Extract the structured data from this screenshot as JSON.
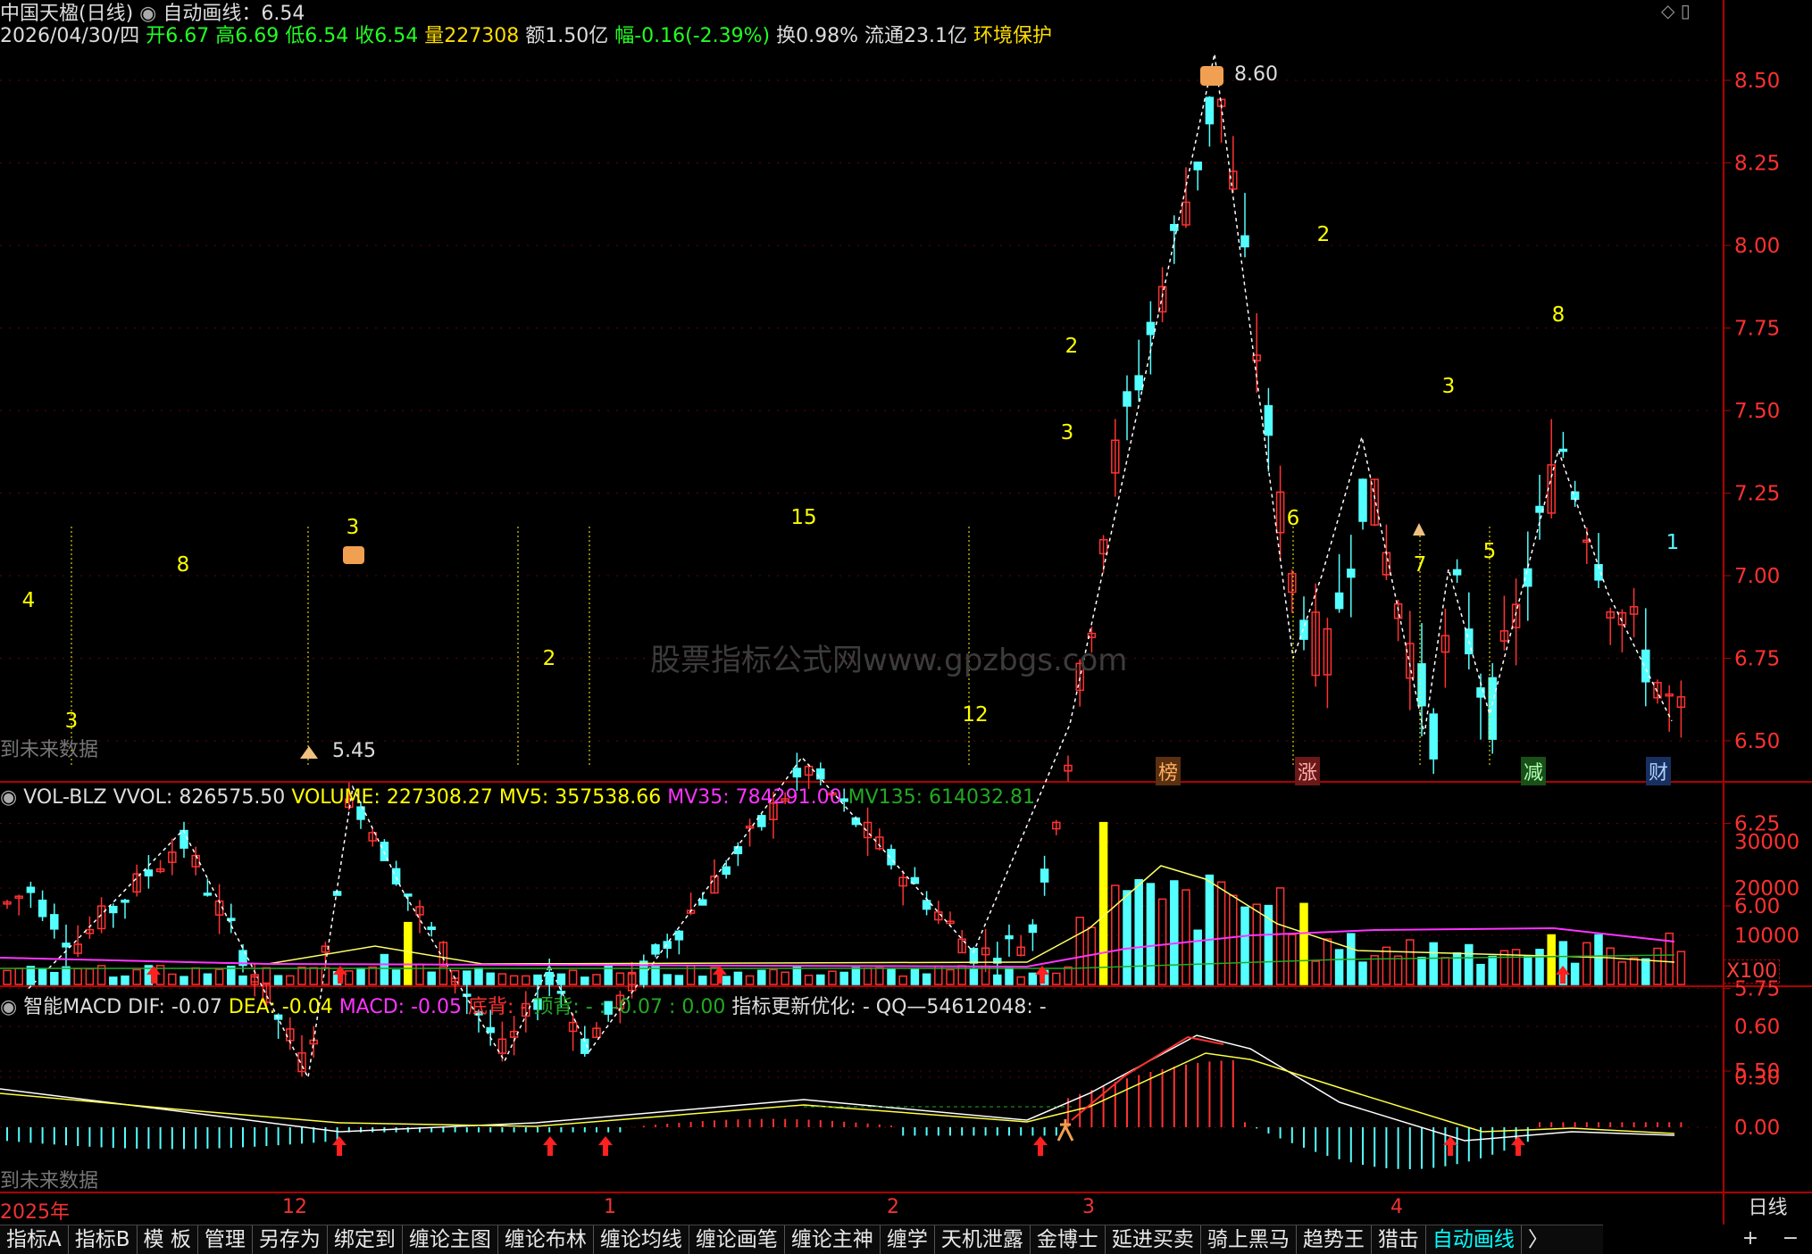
{
  "header": {
    "stock_name": "中国天楹(日线)",
    "indicator_title": "自动画线：6.54",
    "date": "2026/04/30/四",
    "open": "开6.67",
    "high": "高6.69",
    "low": "低6.54",
    "close": "收6.54",
    "volume": "量227308",
    "amount": "额1.50亿",
    "change": "幅-0.16(-2.39%)",
    "turnover": "换0.98%",
    "float": "流通23.1亿",
    "sector": "环境保护"
  },
  "watermark": "股票指标公式网www.gpzbgs.com",
  "future_data_label": "到未来数据",
  "badges": [
    "榜",
    "涨",
    "减",
    "财"
  ],
  "price_axis": [
    "8.50",
    "8.25",
    "8.00",
    "7.75",
    "7.50",
    "7.25",
    "7.00",
    "6.75",
    "6.50",
    "6.25",
    "6.00",
    "5.75",
    "5.50"
  ],
  "annotations": {
    "high_label": "8.60",
    "low_label": "5.45",
    "counts": [
      "4",
      "3",
      "8",
      "3",
      "2",
      "15",
      "12",
      "2",
      "6",
      "2",
      "7",
      "3",
      "5",
      "8",
      "1",
      "3"
    ]
  },
  "volume_panel": {
    "name": "VOL-BLZ",
    "vvol": "VVOL: 826575.50",
    "volume": "VOLUME: 227308.27",
    "mv5": "MV5: 357538.66",
    "mv35": "MV35: 784291.00",
    "mv135": "MV135: 614032.81",
    "axis": [
      "30000",
      "20000",
      "10000"
    ],
    "unit": "X100"
  },
  "macd_panel": {
    "name": "智能MACD",
    "dif": "DIF: -0.07",
    "dea": "DEA: -0.04",
    "macd": "MACD: -0.05",
    "bottom_div": "底背: -",
    "top_div": "顶背: -",
    "extra": ": -0.07",
    "extra2": ": 0.00",
    "update": "指标更新优化: -",
    "qq": "QQ—54612048: -",
    "axis": [
      "0.60",
      "0.30",
      "0.00"
    ]
  },
  "time_axis": [
    "2025年",
    "12",
    "1",
    "2",
    "3",
    "4"
  ],
  "tabs": [
    "指标A",
    "指标B",
    "模 板",
    "管理",
    "另存为",
    "绑定到",
    "缠论主图",
    "缠论布林",
    "缠论均线",
    "缠论画笔",
    "缠论主神",
    "缠学",
    "天机泄露",
    "金博士",
    "延进买卖",
    "骑上黑马",
    "趋势王",
    "猎击",
    "自动画线"
  ],
  "tab_more": "〉",
  "period": "日线",
  "zoom_in": "+",
  "zoom_out": "−",
  "colors": {
    "up": "#ff3232",
    "down": "#54ffff",
    "axis": "#b00000",
    "yellow": "#ffff00",
    "magenta": "#ff00ff",
    "green": "#00a000"
  }
}
